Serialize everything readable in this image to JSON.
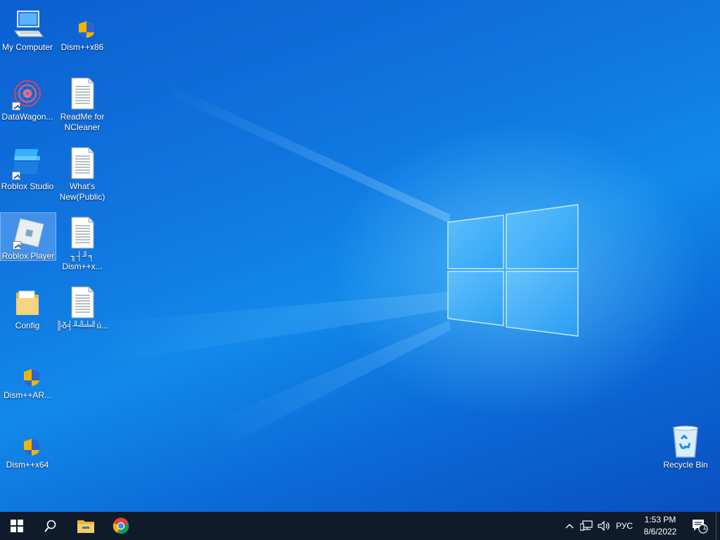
{
  "desktop": {
    "icons": [
      {
        "label": "My Computer",
        "icon": "computer-icon",
        "shortcut": false
      },
      {
        "label": "Dism++x86",
        "icon": "uac-shield-icon",
        "shortcut": false
      },
      {
        "label": "DataWagon...",
        "icon": "datawagon-icon",
        "shortcut": true
      },
      {
        "label": "ReadMe for NCleaner",
        "icon": "text-document-icon",
        "shortcut": false
      },
      {
        "label": "Roblox Studio",
        "icon": "roblox-studio-icon",
        "shortcut": true
      },
      {
        "label": "What's New(Public)",
        "icon": "text-document-icon",
        "shortcut": false
      },
      {
        "label": "Roblox Player",
        "icon": "roblox-player-icon",
        "shortcut": true,
        "selected": true
      },
      {
        "label": "╖┤╜╕ Dism++x...",
        "icon": "text-document-icon",
        "shortcut": false
      },
      {
        "label": "Config",
        "icon": "folder-icon",
        "shortcut": false
      },
      {
        "label": "╠δ╡╨╩╧╝ú...",
        "icon": "text-document-icon",
        "shortcut": false
      },
      {
        "label": "Dism++AR...",
        "icon": "uac-shield-icon",
        "shortcut": false
      },
      {
        "label": "Dism++x64",
        "icon": "uac-shield-icon",
        "shortcut": false
      },
      {
        "label": "Recycle Bin",
        "icon": "recycle-bin-icon",
        "shortcut": false
      }
    ]
  },
  "taskbar": {
    "start": "windows-start-icon",
    "search": "search-icon",
    "pinned": [
      "file-explorer-icon",
      "chrome-icon"
    ],
    "tray": {
      "language": "РУС",
      "time": "1:53 PM",
      "date": "8/6/2022",
      "notifications_count": "1"
    }
  },
  "colors": {
    "taskbar": "#0f1b2b",
    "desktop_blue": "#0c6ad8"
  }
}
